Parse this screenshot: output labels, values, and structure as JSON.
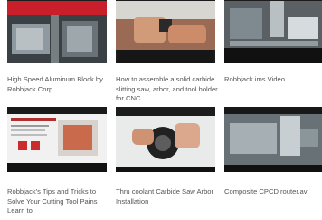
{
  "videos": [
    {
      "title": "High Speed Aluminum Block by Robbjack Corp",
      "thumbnail_icon": "machining-block-thumbnail"
    },
    {
      "title": "How to assemble a solid carbide slitting saw, arbor, and tool holder for CNC",
      "thumbnail_icon": "slitting-saw-assembly-thumbnail"
    },
    {
      "title": "Robbjack ims Video",
      "thumbnail_icon": "cnc-machining-thumbnail"
    },
    {
      "title": "Robbjack's Tips and Tricks to Solve Your Cutting Tool Pains Learn to",
      "thumbnail_icon": "web-page-thumbnail"
    },
    {
      "title": "Thru coolant Carbide Saw Arbor Installation",
      "thumbnail_icon": "saw-arbor-thumbnail"
    },
    {
      "title": "Composite CPCD router.avi",
      "thumbnail_icon": "router-machining-thumbnail"
    }
  ]
}
